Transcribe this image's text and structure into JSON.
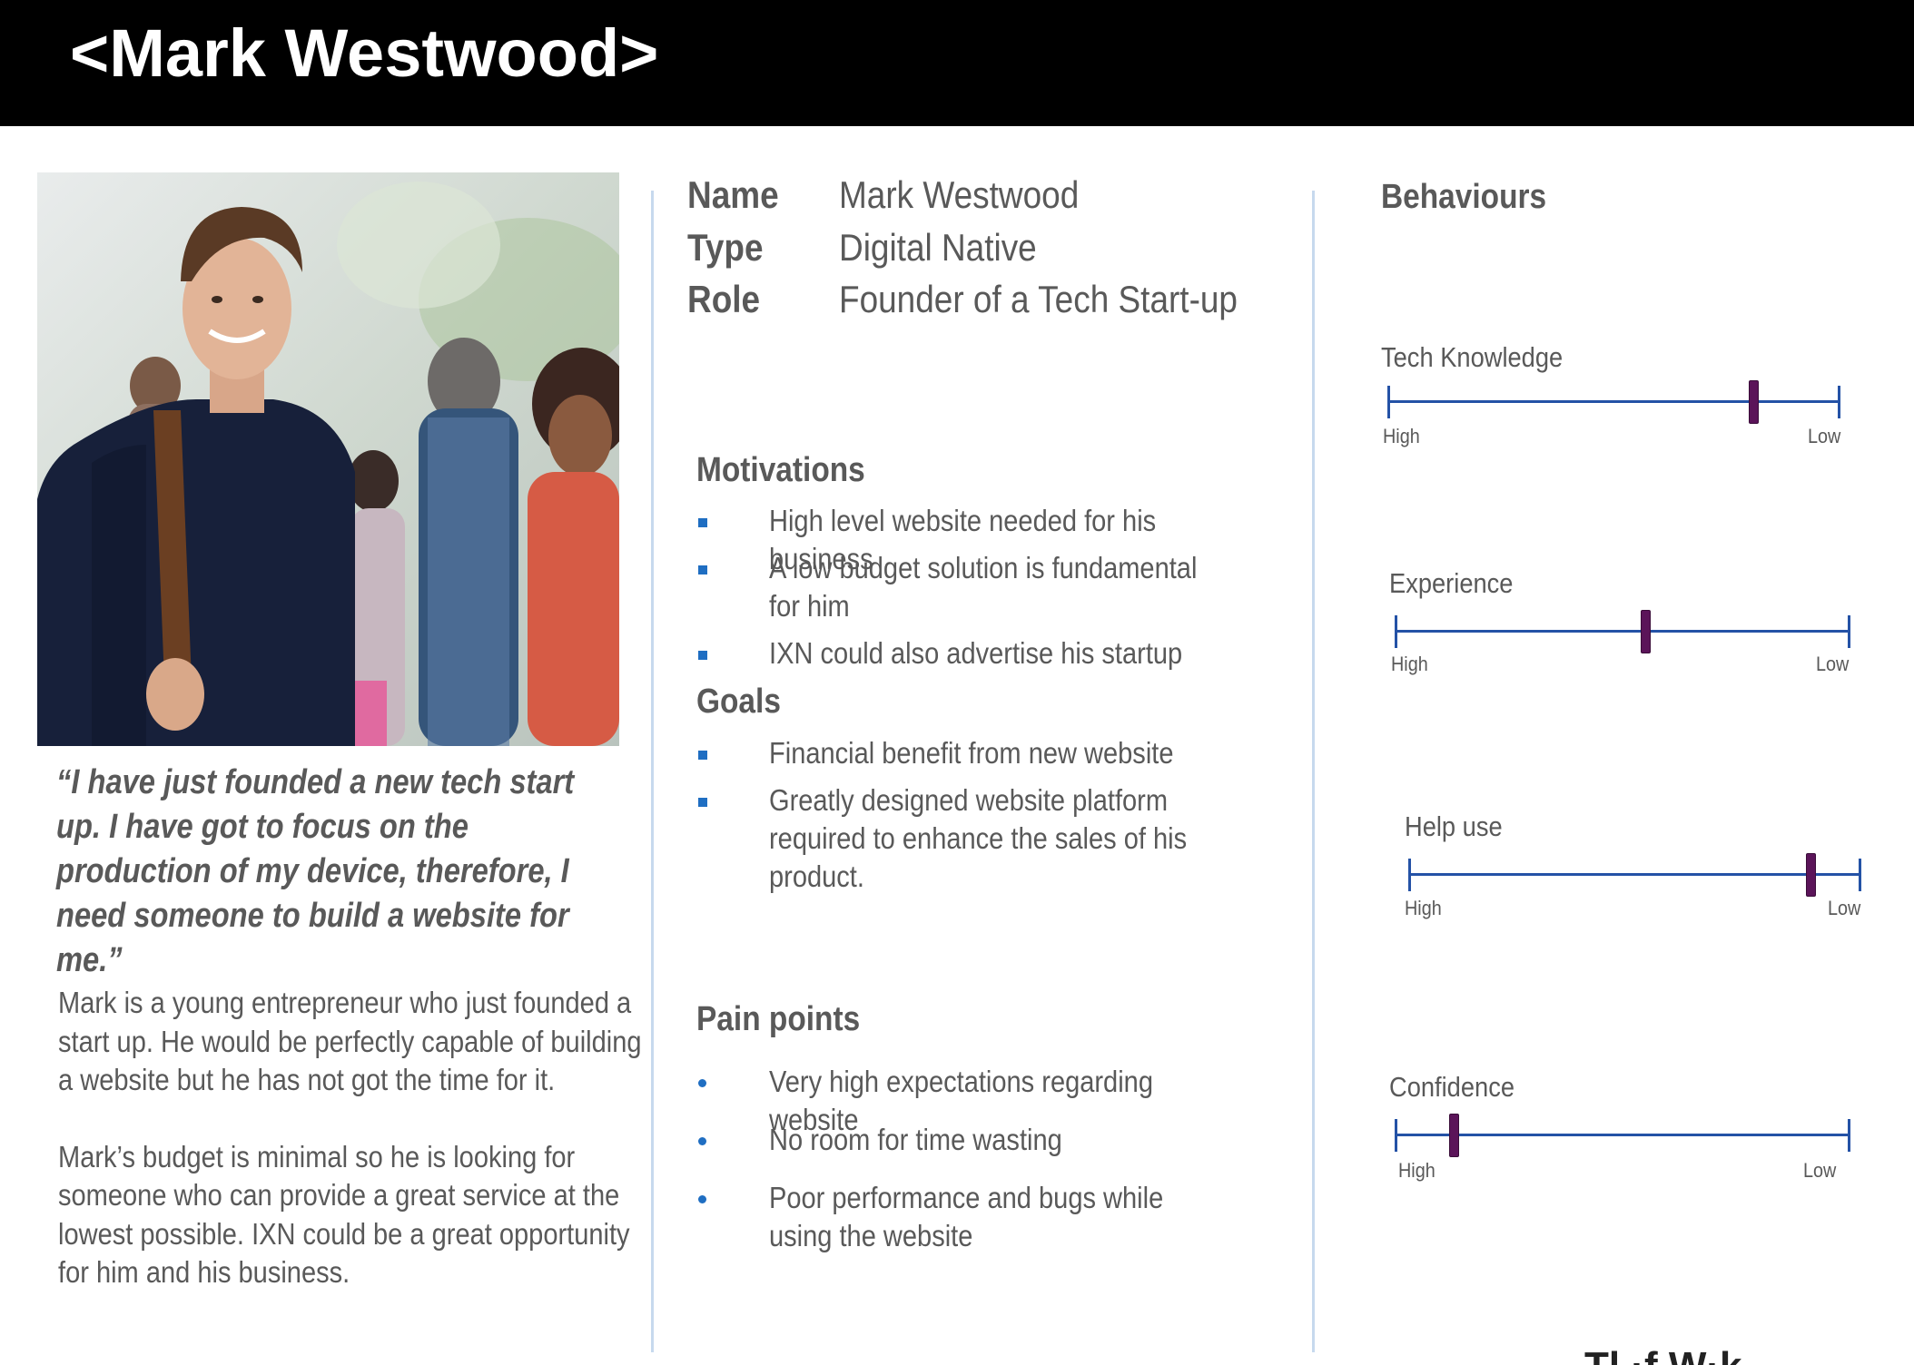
{
  "header": {
    "title": "<Mark Westwood>"
  },
  "profile": {
    "quote": "“I have just founded a new tech start up. I have got to focus on the production of my device, therefore, I need someone to build a website for me.”",
    "bio": [
      "Mark is a young entrepreneur who just founded a start up. He would be perfectly capable of building a website but he  has not got the time for it.",
      "Mark’s budget is minimal so he is looking for someone who can provide a great service at the lowest possible. IXN could be a great opportunity for him and his business."
    ]
  },
  "identity": [
    {
      "key": "Name",
      "value": "Mark Westwood"
    },
    {
      "key": "Type",
      "value": "Digital Native"
    },
    {
      "key": "Role",
      "value": "Founder of a Tech Start-up"
    }
  ],
  "motivations": {
    "title": "Motivations",
    "items": [
      "High level website needed for his business",
      "A low budget solution is fundamental for him",
      "IXN could also advertise his startup"
    ]
  },
  "goals": {
    "title": "Goals",
    "items": [
      "Financial benefit from new website",
      "Greatly designed website platform required to enhance the sales of his product."
    ]
  },
  "pain_points": {
    "title": "Pain points",
    "items": [
      "Very high expectations regarding website",
      "No room for time wasting",
      "Poor performance and bugs while using the website"
    ]
  },
  "behaviours": {
    "title": "Behaviours",
    "scales": [
      {
        "label": "Tech Knowledge",
        "high": "High",
        "low": "Low",
        "position_from_high": 0.81
      },
      {
        "label": "Experience",
        "high": "High",
        "low": "Low",
        "position_from_high": 0.55
      },
      {
        "label": "Help use",
        "high": "High",
        "low": "Low",
        "position_from_high": 0.89
      },
      {
        "label": "Confidence",
        "high": "High",
        "low": "Low",
        "position_from_high": 0.13
      }
    ]
  },
  "footer": {
    "fragment": "Tl    ·f W·k"
  },
  "colors": {
    "header_bg": "#000000",
    "accent": "#1f6ec2",
    "scale_line": "#2452a6",
    "marker": "#5b1459",
    "divider": "#c7d9ee"
  }
}
